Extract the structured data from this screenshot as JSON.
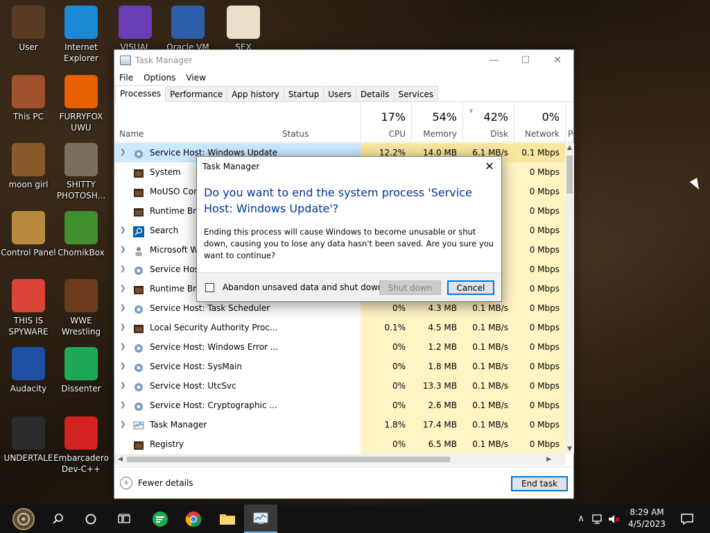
{
  "desktop": {
    "icons": [
      {
        "label": "User",
        "icon": "user-icon",
        "color": "#5a3a22"
      },
      {
        "label": "Internet Explorer",
        "icon": "edge-icon",
        "color": "#1b8ad6"
      },
      {
        "label": "VISUAL",
        "icon": "visual-studio-icon",
        "color": "#6a3fb5"
      },
      {
        "label": "Oracle VM",
        "icon": "virtualbox-icon",
        "color": "#2d5fa8"
      },
      {
        "label": "SEX",
        "icon": "hxd-icon",
        "color": "#e8e0c8"
      },
      {
        "label": "This PC",
        "icon": "computer-icon",
        "color": "#a0522d"
      },
      {
        "label": "FURRYFOX UWU",
        "icon": "firefox-icon",
        "color": "#e66000"
      },
      {
        "label": "moon girl",
        "icon": "folder-icon",
        "color": "#8b5a2b"
      },
      {
        "label": "SHITTY PHOTOSH...",
        "icon": "gimp-icon",
        "color": "#7a6e5e"
      },
      {
        "label": "Control Panel",
        "icon": "lightbulb-icon",
        "color": "#b98a3e"
      },
      {
        "label": "ChomikBox",
        "icon": "chomikbox-icon",
        "color": "#3f8f2f"
      },
      {
        "label": "THIS IS SPYWARE",
        "icon": "chrome-icon",
        "color": "#db4437"
      },
      {
        "label": "WWE Wrestling",
        "icon": "tv-icon",
        "color": "#6b3b1e"
      },
      {
        "label": "Audacity",
        "icon": "audacity-icon",
        "color": "#1d4fa3"
      },
      {
        "label": "Dissenter",
        "icon": "dissenter-icon",
        "color": "#1fa855"
      },
      {
        "label": "UNDERTALE",
        "icon": "unity-icon",
        "color": "#2b2b2b"
      },
      {
        "label": "Embarcadero Dev-C++",
        "icon": "devcpp-icon",
        "color": "#d42222"
      }
    ]
  },
  "taskmanager": {
    "title": "Task Manager",
    "menu": [
      "File",
      "Options",
      "View"
    ],
    "tabs": [
      "Processes",
      "Performance",
      "App history",
      "Startup",
      "Users",
      "Details",
      "Services"
    ],
    "columns": {
      "name": "Name",
      "status": "Status",
      "cpu": {
        "pct": "17%",
        "label": "CPU"
      },
      "memory": {
        "pct": "54%",
        "label": "Memory"
      },
      "disk": {
        "pct": "42%",
        "label": "Disk"
      },
      "network": {
        "pct": "0%",
        "label": "Network"
      },
      "power": "Po"
    },
    "processes": [
      {
        "name": "Service Host: Windows Update",
        "cpu": "12.2%",
        "mem": "14.0 MB",
        "disk": "6.1 MB/s",
        "net": "0.1 Mbps",
        "expand": true,
        "icon": "gear-icon"
      },
      {
        "name": "System",
        "cpu": "",
        "mem": "",
        "disk": "",
        "net": "0 Mbps",
        "expand": false,
        "icon": "window-icon"
      },
      {
        "name": "MoUSO Core",
        "cpu": "",
        "mem": "",
        "disk": "",
        "net": "0 Mbps",
        "expand": false,
        "icon": "window-icon"
      },
      {
        "name": "Runtime Bro",
        "cpu": "",
        "mem": "",
        "disk": "",
        "net": "0 Mbps",
        "expand": false,
        "icon": "window-icon"
      },
      {
        "name": "Search",
        "cpu": "",
        "mem": "",
        "disk": "",
        "net": "0 Mbps",
        "expand": true,
        "icon": "search-icon"
      },
      {
        "name": "Microsoft W",
        "cpu": "",
        "mem": "",
        "disk": "",
        "net": "0 Mbps",
        "expand": true,
        "icon": "user-icon"
      },
      {
        "name": "Service Hos",
        "cpu": "",
        "mem": "",
        "disk": "",
        "net": "0 Mbps",
        "expand": true,
        "icon": "gear-icon"
      },
      {
        "name": "Runtime Bro",
        "cpu": "",
        "mem": "",
        "disk": "",
        "net": "0 Mbps",
        "expand": true,
        "icon": "window-icon"
      },
      {
        "name": "Service Host: Task Scheduler",
        "cpu": "0%",
        "mem": "4.3 MB",
        "disk": "0.1 MB/s",
        "net": "0 Mbps",
        "expand": true,
        "icon": "gear-icon"
      },
      {
        "name": "Local Security Authority Proc...",
        "cpu": "0.1%",
        "mem": "4.5 MB",
        "disk": "0.1 MB/s",
        "net": "0 Mbps",
        "expand": true,
        "icon": "window-icon"
      },
      {
        "name": "Service Host: Windows Error ...",
        "cpu": "0%",
        "mem": "1.2 MB",
        "disk": "0.1 MB/s",
        "net": "0 Mbps",
        "expand": true,
        "icon": "gear-icon"
      },
      {
        "name": "Service Host: SysMain",
        "cpu": "0%",
        "mem": "1.8 MB",
        "disk": "0.1 MB/s",
        "net": "0 Mbps",
        "expand": true,
        "icon": "gear-icon"
      },
      {
        "name": "Service Host: UtcSvc",
        "cpu": "0%",
        "mem": "13.3 MB",
        "disk": "0.1 MB/s",
        "net": "0 Mbps",
        "expand": true,
        "icon": "gear-icon"
      },
      {
        "name": "Service Host: Cryptographic ...",
        "cpu": "0%",
        "mem": "2.6 MB",
        "disk": "0.1 MB/s",
        "net": "0 Mbps",
        "expand": true,
        "icon": "gear-icon"
      },
      {
        "name": "Task Manager",
        "cpu": "1.8%",
        "mem": "17.4 MB",
        "disk": "0.1 MB/s",
        "net": "0 Mbps",
        "expand": true,
        "icon": "taskmgr-icon"
      },
      {
        "name": "Registry",
        "cpu": "0%",
        "mem": "6.5 MB",
        "disk": "0.1 MB/s",
        "net": "0 Mbps",
        "expand": false,
        "icon": "window-icon"
      }
    ],
    "footer": {
      "fewer_details": "Fewer details",
      "end_task": "End task"
    }
  },
  "dialog": {
    "title": "Task Manager",
    "question": "Do you want to end the system process 'Service Host: Windows Update'?",
    "message": "Ending this process will cause Windows to become unusable or shut down, causing you to lose any data hasn't been saved. Are you sure you want to continue?",
    "checkbox_label": "Abandon unsaved data and shut down.",
    "shutdown_label": "Shut down",
    "cancel_label": "Cancel"
  },
  "taskbar": {
    "time": "8:29 AM",
    "date": "4/5/2023",
    "accent": "#76b9ed"
  }
}
